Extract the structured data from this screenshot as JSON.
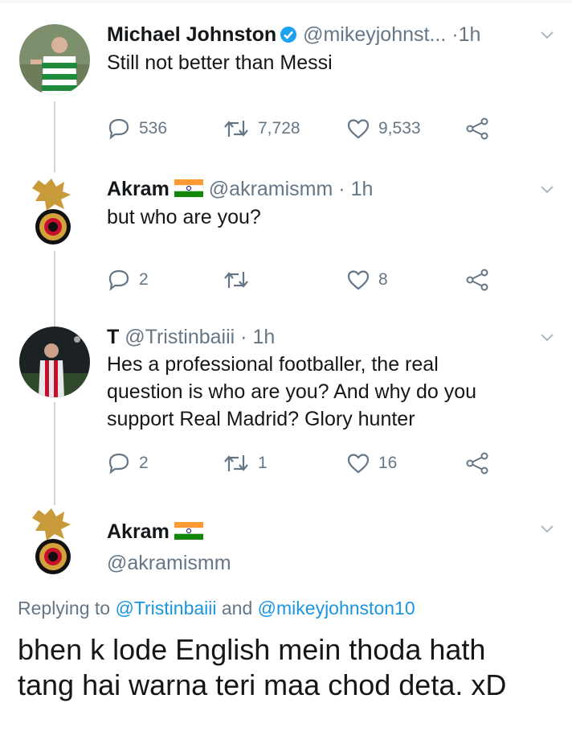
{
  "tweets": [
    {
      "name": "Michael Johnston",
      "handle": "@mikeyjohnst...",
      "time": "1h",
      "text": "Still not better than Messi",
      "reply_count": "536",
      "retweet_count": "7,728",
      "like_count": "9,533"
    },
    {
      "name": "Akram",
      "handle": "@akramismm",
      "time": "1h",
      "text": "but who are you?",
      "reply_count": "2",
      "retweet_count": "",
      "like_count": "8"
    },
    {
      "name": "T",
      "handle": "@Tristinbaiii",
      "time": "1h",
      "text_lines": [
        "Hes a professional footballer, the real",
        "question is who are you? And why do you",
        "support Real Madrid? Glory hunter"
      ],
      "reply_count": "2",
      "retweet_count": "1",
      "like_count": "16"
    }
  ],
  "main_tweet": {
    "name": "Akram",
    "handle": "@akramismm",
    "replying_prefix": "Replying to",
    "mention_1": "@Tristinbaiii",
    "replying_and": "and",
    "mention_2": "@mikeyjohnston10",
    "text_lines": [
      "bhen k lode English mein thoda hath",
      "tang hai warna teri maa chod deta. xD"
    ]
  },
  "dot_separator": "·",
  "colors": {
    "text": "#14171a",
    "secondary": "#657786",
    "link": "#1b95e0",
    "verified": "#1da1f2",
    "thread_line": "#cdd6dd"
  },
  "icons": [
    "verified-badge-icon",
    "india-flag-icon",
    "reply-icon",
    "retweet-icon",
    "like-icon",
    "share-icon",
    "chevron-down-icon"
  ]
}
